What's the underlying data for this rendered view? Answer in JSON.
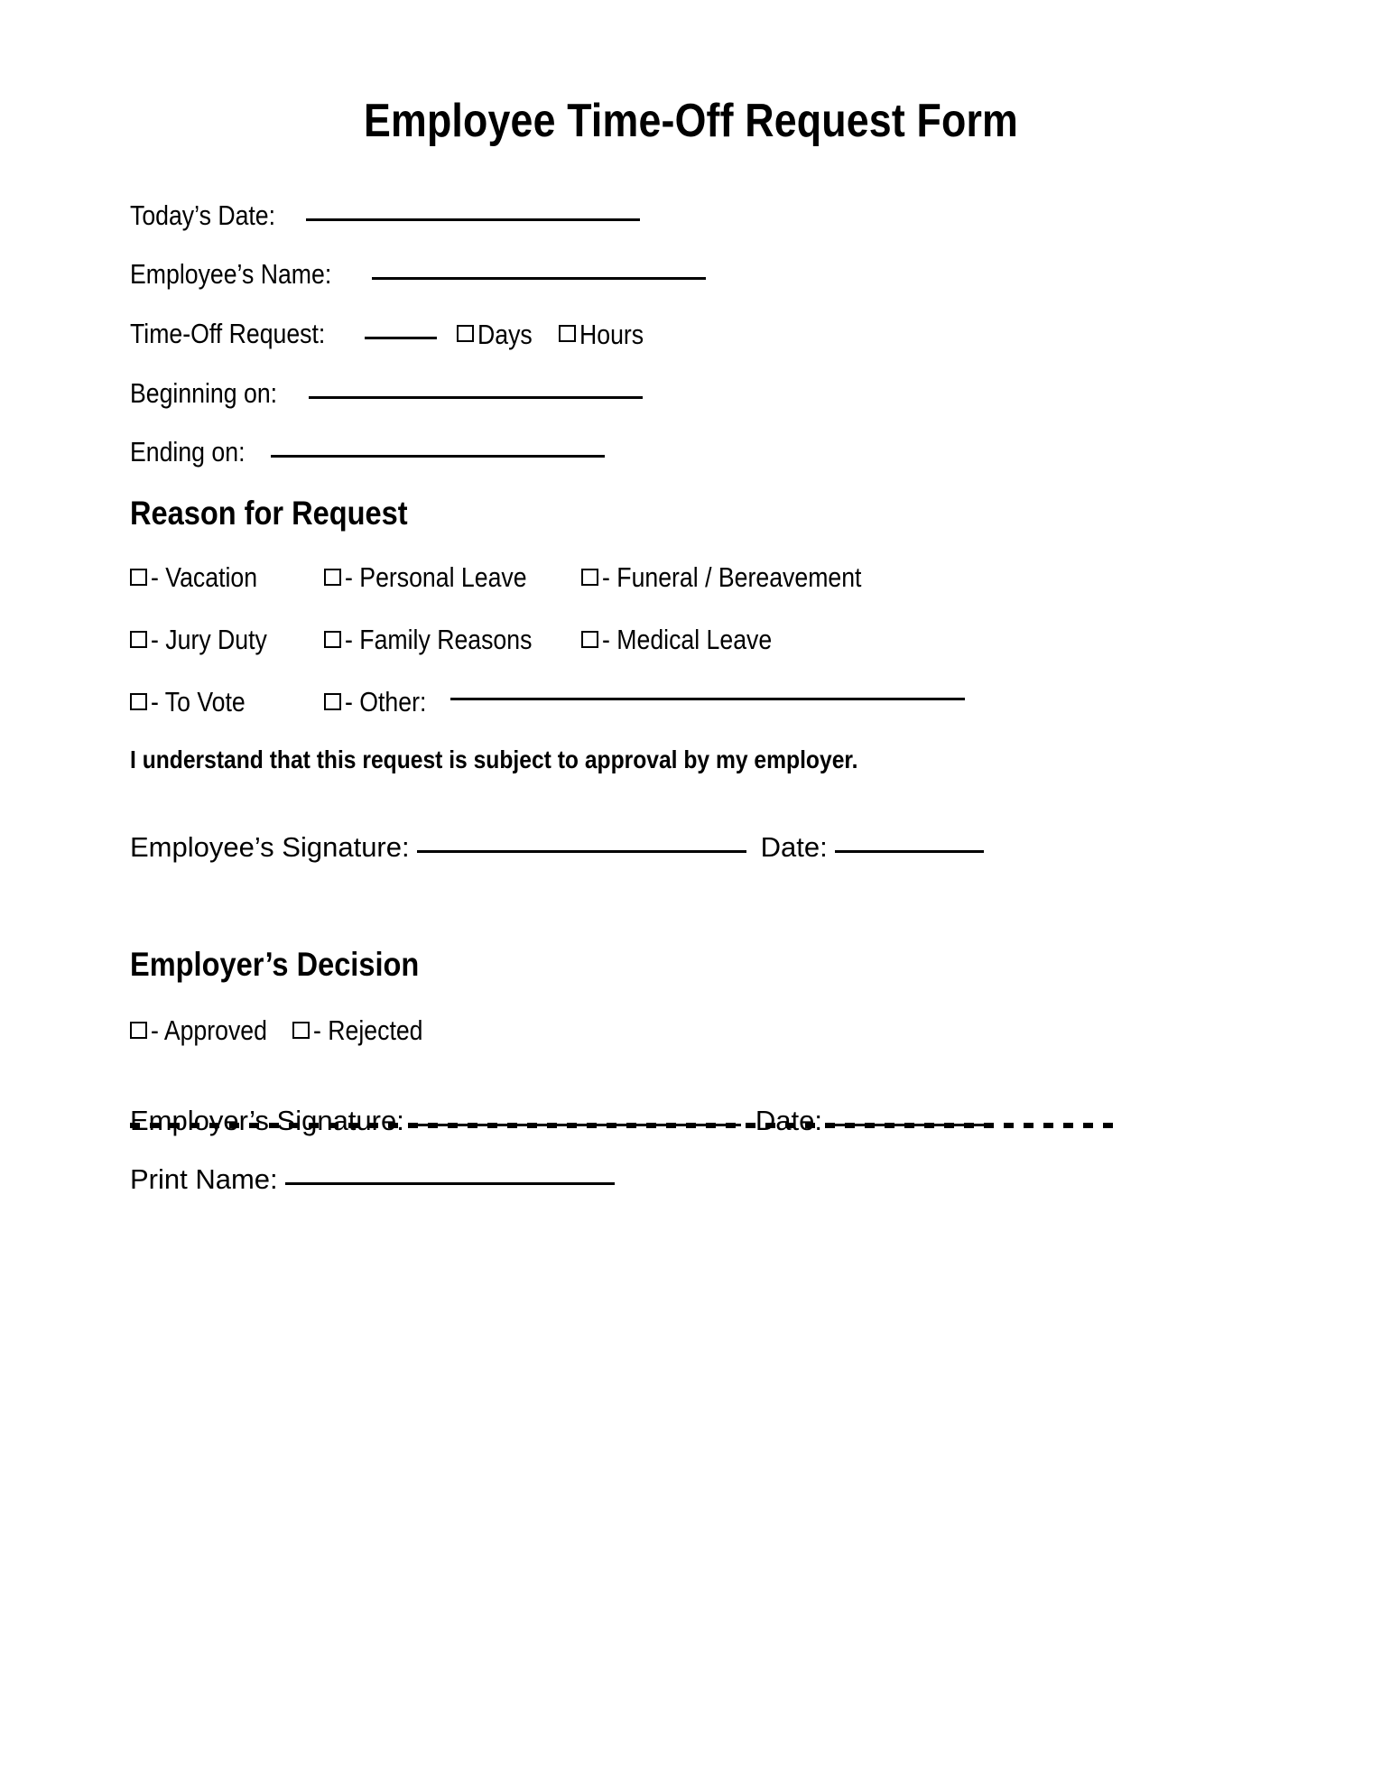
{
  "document": {
    "title": "Employee Time-Off Request Form"
  },
  "fields": {
    "todays_date": {
      "label": "Today’s Date:",
      "value": "",
      "rule_width": 370
    },
    "employee_name": {
      "label": "Employee’s Name:",
      "value": "",
      "rule_width": 370
    },
    "time_off_request": {
      "label": "Time-Off Request:",
      "value": "",
      "rule_width": 80,
      "unit_days": {
        "checkbox": "checkbox-unchecked",
        "label": "Days",
        "checked": false
      },
      "unit_hours": {
        "checkbox": "checkbox-unchecked",
        "label": "Hours",
        "checked": false
      }
    },
    "beginning_on": {
      "label": "Beginning on:",
      "value": "",
      "rule_width": 370
    },
    "ending_on": {
      "label": "Ending on:",
      "value": "",
      "rule_width": 370
    }
  },
  "reason_section": {
    "heading": "Reason for Request",
    "options": [
      {
        "label": "- Vacation",
        "checked": false
      },
      {
        "label": "- Personal Leave",
        "checked": false
      },
      {
        "label": "- Funeral / Bereavement",
        "checked": false
      },
      {
        "label": "- Jury Duty",
        "checked": false
      },
      {
        "label": "- Family Reasons",
        "checked": false
      },
      {
        "label": "- Medical Leave",
        "checked": false
      },
      {
        "label": "- To Vote",
        "checked": false
      },
      {
        "label": "- Other:",
        "checked": false
      }
    ],
    "other_rule_width": 570
  },
  "acknowledgement": {
    "text": "I understand that this request is subject to approval by my employer."
  },
  "employee_signature": {
    "label": "Employee’s Signature:",
    "rule_width": 365,
    "date_label": "Date:",
    "date_rule_width": 165
  },
  "divider": {
    "style": "dashed"
  },
  "employer_section": {
    "heading": "Employer’s Decision",
    "decisions": [
      {
        "label": "- Approved",
        "checked": false
      },
      {
        "label": "- Rejected",
        "checked": false
      }
    ],
    "signature": {
      "label": "Employer’s Signature:",
      "rule_width": 365,
      "date_label": "Date:",
      "date_rule_width": 180
    },
    "print_name": {
      "label": "Print Name:",
      "rule_width": 365
    }
  },
  "colors": {
    "ink": "#000000",
    "paper": "#ffffff"
  }
}
